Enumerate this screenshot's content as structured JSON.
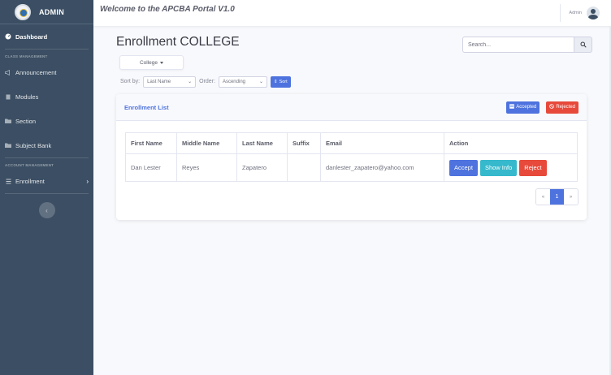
{
  "sidebar": {
    "brand": "ADMIN",
    "dashboard": "Dashboard",
    "heading_class": "CLASS MANAGEMENT",
    "announcement": "Announcement",
    "modules": "Modules",
    "section": "Section",
    "subject_bank": "Subject Bank",
    "heading_account": "ACCOUNT MANAGEMENT",
    "enrollment": "Enrollment",
    "toggle": "‹"
  },
  "topbar": {
    "title": "Welcome to the APCBA Portal V1.0",
    "user": "Admin"
  },
  "main": {
    "title": "Enrollment COLLEGE",
    "search_placeholder": "Search...",
    "college_dropdown": "College",
    "sort_by_label": "Sort by:",
    "sort_by_value": "Last Name",
    "order_label": "Order:",
    "order_value": "Ascending",
    "sort_button": "Sort"
  },
  "card": {
    "title": "Enrollment List",
    "accepted_button": "Accepted",
    "rejected_button": "Rejected",
    "columns": [
      "First Name",
      "Middle Name",
      "Last Name",
      "Suffix",
      "Email",
      "Action"
    ],
    "rows": [
      {
        "first_name": "Dan Lester",
        "middle_name": "Reyes",
        "last_name": "Zapatero",
        "suffix": "",
        "email": "danlester_zapatero@yahoo.com",
        "accept": "Accept",
        "show_info": "Show Info",
        "reject": "Reject"
      }
    ],
    "pagination": {
      "prev": "«",
      "current": "1",
      "next": "»"
    }
  },
  "colors": {
    "sidebar": "#3b4e63",
    "primary": "#4e73df",
    "info": "#36b9cc",
    "danger": "#e74a3b"
  }
}
